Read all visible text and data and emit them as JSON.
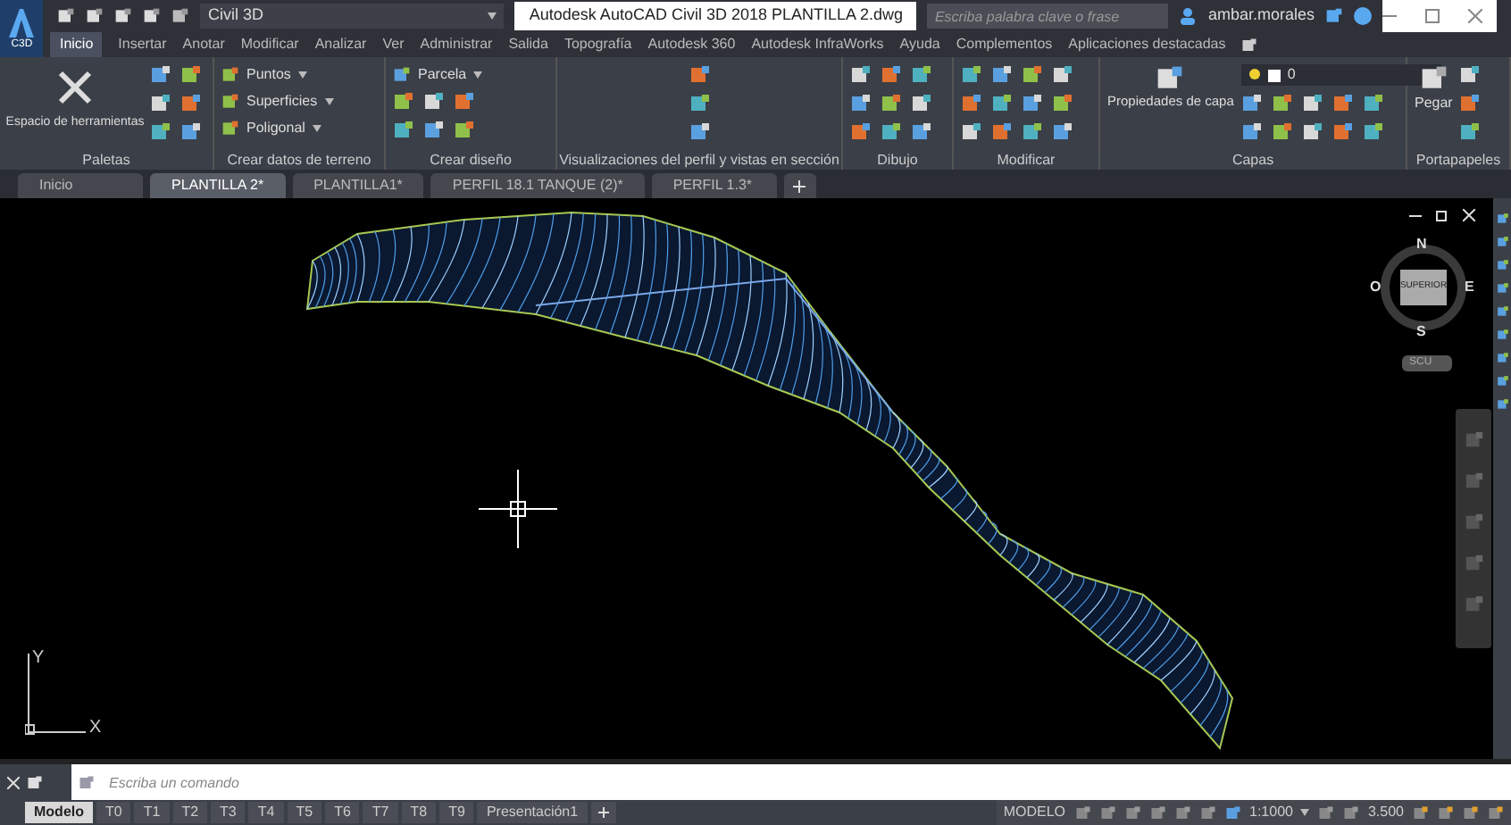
{
  "title_bar": {
    "app_badge": "C3D",
    "workspace": "Civil 3D",
    "title": "Autodesk AutoCAD Civil 3D 2018   PLANTILLA 2.dwg",
    "search": {
      "placeholder": "Escriba palabra clave o frase"
    },
    "user": "ambar.morales"
  },
  "ribbon_tabs": [
    {
      "label": "Inicio",
      "selected": true
    },
    {
      "label": "Insertar",
      "selected": false
    },
    {
      "label": "Anotar",
      "selected": false
    },
    {
      "label": "Modificar",
      "selected": false
    },
    {
      "label": "Analizar",
      "selected": false
    },
    {
      "label": "Ver",
      "selected": false
    },
    {
      "label": "Administrar",
      "selected": false
    },
    {
      "label": "Salida",
      "selected": false
    },
    {
      "label": "Topografía",
      "selected": false
    },
    {
      "label": "Autodesk 360",
      "selected": false
    },
    {
      "label": "Autodesk InfraWorks",
      "selected": false
    },
    {
      "label": "Ayuda",
      "selected": false
    },
    {
      "label": "Complementos",
      "selected": false
    },
    {
      "label": "Aplicaciones destacadas",
      "selected": false
    }
  ],
  "ribbon_panels": [
    {
      "title": "Paletas",
      "buttons": [
        "Espacio de herramientas"
      ]
    },
    {
      "title": "Crear datos de terreno",
      "buttons": [
        "Puntos",
        "Superficies",
        "Poligonal"
      ]
    },
    {
      "title": "Crear diseño",
      "buttons": [
        "Parcela"
      ]
    },
    {
      "title": "Visualizaciones del perfil y vistas en sección"
    },
    {
      "title": "Dibujo"
    },
    {
      "title": "Modificar"
    },
    {
      "title": "Capas",
      "buttons": [
        "Propiedades de capa"
      ],
      "layer": "0"
    },
    {
      "title": "Portapapeles",
      "buttons": [
        "Pegar"
      ]
    }
  ],
  "document_tabs": [
    {
      "label": "Inicio",
      "selected": false
    },
    {
      "label": "PLANTILLA 2*",
      "selected": true
    },
    {
      "label": "PLANTILLA1*",
      "selected": false
    },
    {
      "label": "PERFIL 18.1 TANQUE (2)*",
      "selected": false
    },
    {
      "label": "PERFIL 1.3*",
      "selected": false
    }
  ],
  "viewcube": {
    "north": "N",
    "east": "E",
    "south": "S",
    "west": "O",
    "face": "SUPERIOR",
    "ucs": "SCU"
  },
  "ucs_icon": {
    "y_label": "Y",
    "x_label": "X"
  },
  "command_line": {
    "placeholder": "Escriba un comando"
  },
  "layout_tabs": [
    {
      "label": "Modelo",
      "selected": true
    },
    {
      "label": "T0",
      "selected": false
    },
    {
      "label": "T1",
      "selected": false
    },
    {
      "label": "T2",
      "selected": false
    },
    {
      "label": "T3",
      "selected": false
    },
    {
      "label": "T4",
      "selected": false
    },
    {
      "label": "T5",
      "selected": false
    },
    {
      "label": "T6",
      "selected": false
    },
    {
      "label": "T7",
      "selected": false
    },
    {
      "label": "T8",
      "selected": false
    },
    {
      "label": "T9",
      "selected": false
    },
    {
      "label": "Presentación1",
      "selected": false
    }
  ],
  "status_bar": {
    "mode": "MODELO",
    "scale": "1:1000",
    "value": "3.500"
  }
}
